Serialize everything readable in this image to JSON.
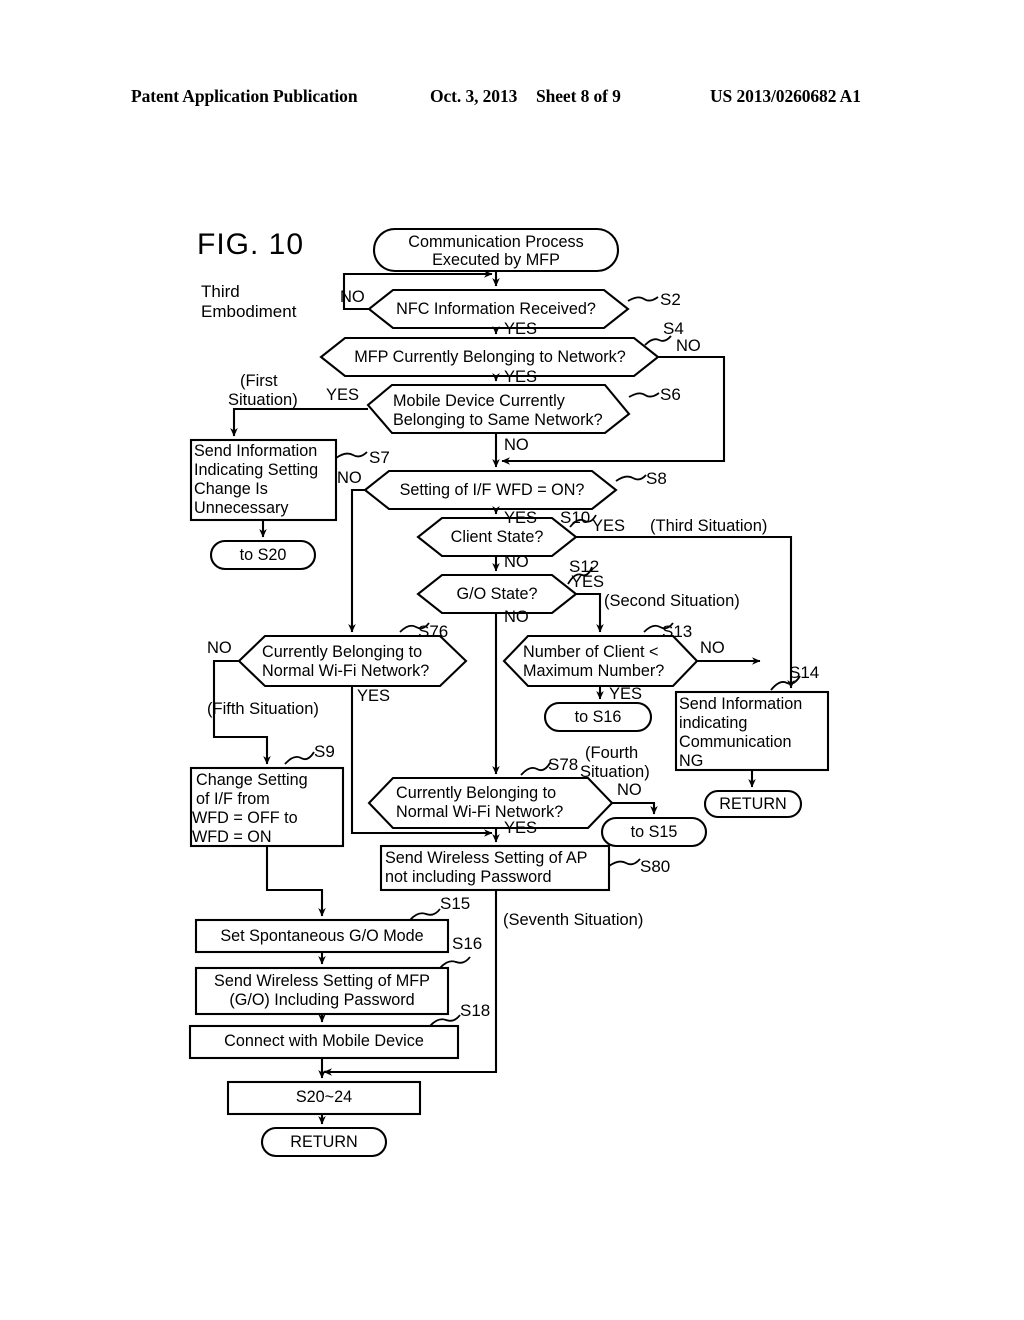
{
  "header": {
    "publication": "Patent Application Publication",
    "date": "Oct. 3, 2013",
    "sheet": "Sheet 8 of 9",
    "patent_number": "US 2013/0260682 A1"
  },
  "figure": {
    "title": "FIG. 10",
    "subtitle_line1": "Third",
    "subtitle_line2": "Embodiment"
  },
  "nodes": {
    "start": {
      "id": "",
      "text_line1": "Communication Process",
      "text_line2": "Executed by MFP"
    },
    "s2": {
      "id": "S2",
      "text_line1": "NFC Information Received?"
    },
    "s4": {
      "id": "S4",
      "text_line1": "MFP Currently Belonging to Network?"
    },
    "s6": {
      "id": "S6",
      "text_line1": "Mobile Device Currently",
      "text_line2": "Belonging to Same Network?"
    },
    "s7": {
      "id": "S7",
      "text_line1": "Send Information",
      "text_line2": "Indicating Setting",
      "text_line3": "Change Is",
      "text_line4": "Unnecessary"
    },
    "to_s20": {
      "id": "",
      "text_line1": "to S20"
    },
    "s8": {
      "id": "S8",
      "text_line1": "Setting of I/F WFD = ON?"
    },
    "s10": {
      "id": "S10",
      "text_line1": "Client State?"
    },
    "s12": {
      "id": "S12",
      "text_line1": "G/O State?"
    },
    "s76": {
      "id": "S76",
      "text_line1": "Currently Belonging to",
      "text_line2": "Normal Wi-Fi Network?"
    },
    "s13": {
      "id": "S13",
      "text_line1": "Number of Client <",
      "text_line2": "Maximum Number?"
    },
    "to_s16": {
      "id": "",
      "text_line1": "to S16"
    },
    "s14": {
      "id": "S14",
      "text_line1": "Send Information",
      "text_line2": "indicating",
      "text_line3": "Communication",
      "text_line4": "NG"
    },
    "return_right": {
      "id": "",
      "text_line1": "RETURN"
    },
    "s9": {
      "id": "S9",
      "text_line1": "Change Setting",
      "text_line2": "of I/F from",
      "text_line3": "WFD = OFF to",
      "text_line4": "WFD = ON"
    },
    "s78": {
      "id": "S78",
      "text_line1": "Currently Belonging to",
      "text_line2": "Normal Wi-Fi Network?"
    },
    "to_s15": {
      "id": "",
      "text_line1": "to S15"
    },
    "s80": {
      "id": "S80",
      "text_line1": "Send Wireless Setting of AP",
      "text_line2": "not including Password"
    },
    "s15": {
      "id": "S15",
      "text_line1": "Set Spontaneous G/O Mode"
    },
    "s16": {
      "id": "S16",
      "text_line1": "Send Wireless Setting of MFP",
      "text_line2": "(G/O) Including Password"
    },
    "s18": {
      "id": "S18",
      "text_line1": "Connect with Mobile Device"
    },
    "s20_24": {
      "id": "",
      "text_line1": "S20~24"
    },
    "return_bottom": {
      "id": "",
      "text_line1": "RETURN"
    }
  },
  "branch_labels": {
    "s2_no": "NO",
    "s2_yes": "YES",
    "s4_no": "NO",
    "s4_yes": "YES",
    "s6_yes": "YES",
    "s6_no": "NO",
    "s8_no": "NO",
    "s8_yes": "YES",
    "s10_yes": "YES",
    "s10_no": "NO",
    "s12_yes": "YES",
    "s12_no": "NO",
    "s76_no": "NO",
    "s76_yes": "YES",
    "s13_no": "NO",
    "s13_yes": "YES",
    "s78_no": "NO",
    "s78_yes": "YES"
  },
  "situations": {
    "first": "(First",
    "first2": "Situation)",
    "third": "(Third Situation)",
    "second": "(Second Situation)",
    "fifth": "(Fifth Situation)",
    "fourth1": "(Fourth",
    "fourth2": "Situation)",
    "seventh": "(Seventh Situation)"
  },
  "colors": {
    "ink": "#000000",
    "paper": "#ffffff"
  }
}
